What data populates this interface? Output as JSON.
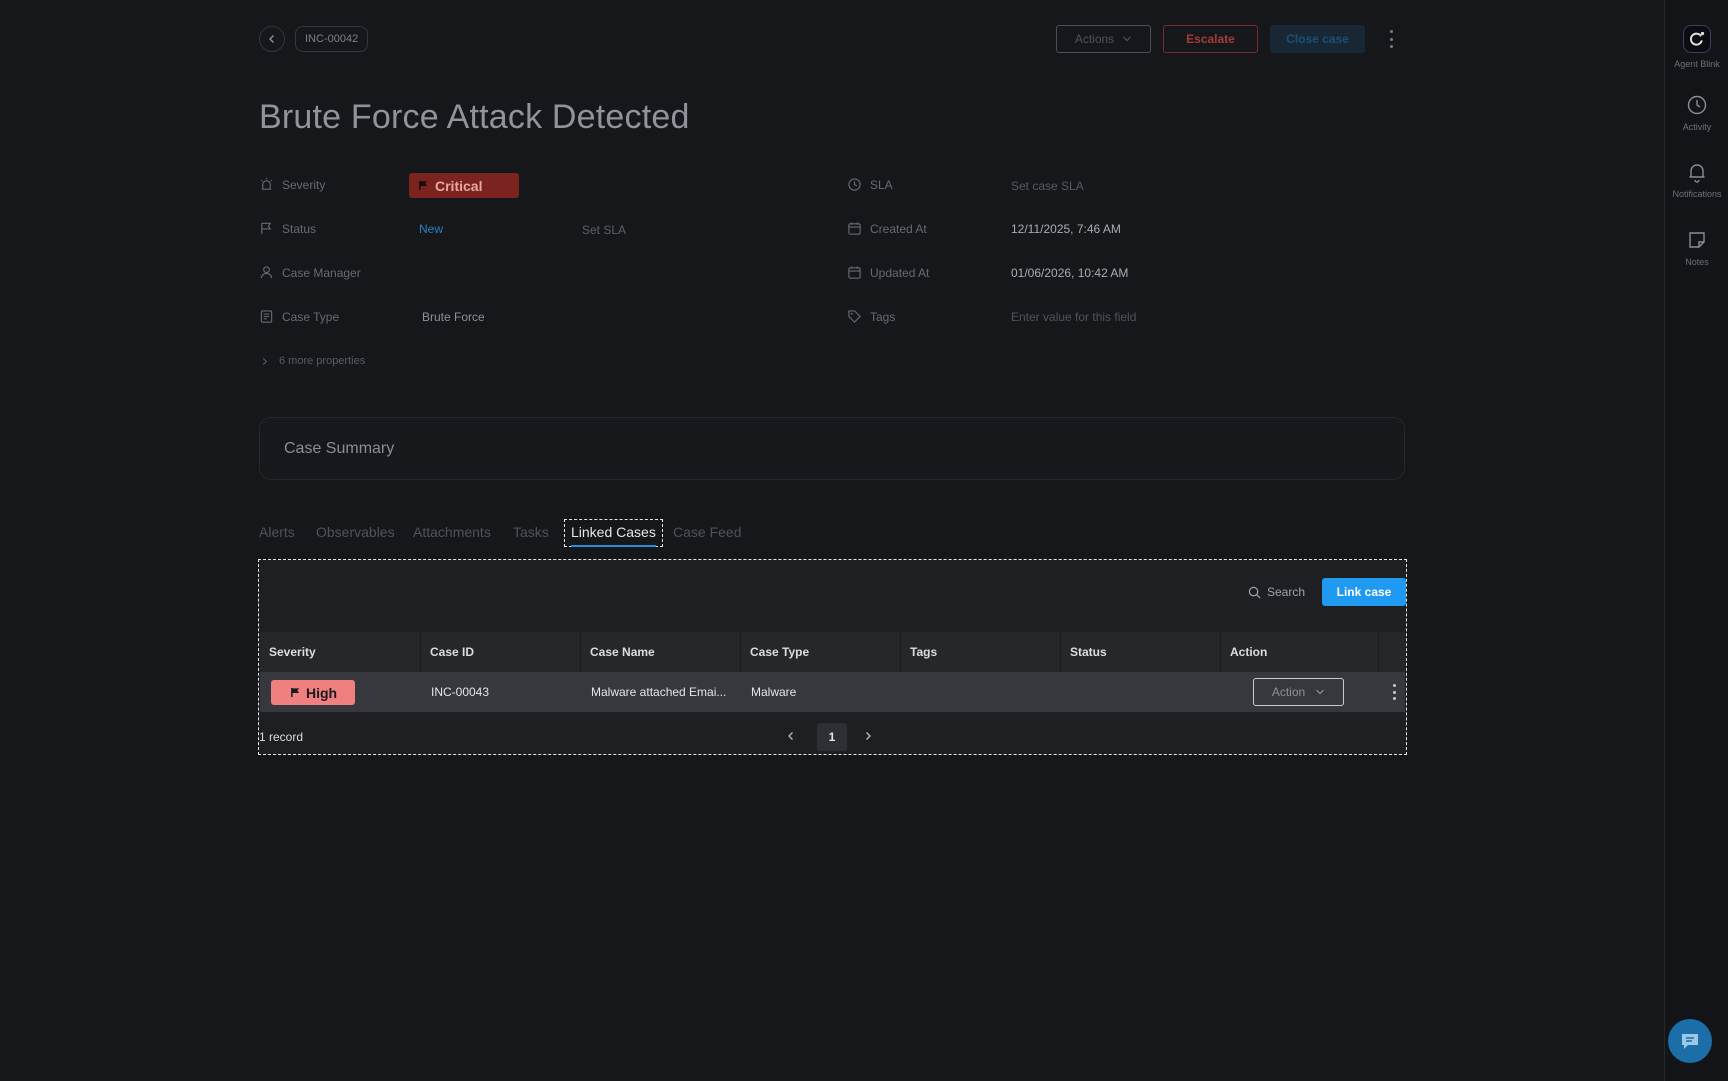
{
  "header": {
    "case_id": "INC-00042",
    "actions_label": "Actions",
    "escalate_label": "Escalate",
    "close_label": "Close case",
    "title": "Brute Force Attack Detected"
  },
  "properties": {
    "severity_label": "Severity",
    "severity_value": "Critical",
    "status_label": "Status",
    "status_value": "New",
    "set_sla_label": "Set SLA",
    "case_manager_label": "Case Manager",
    "case_type_label": "Case Type",
    "case_type_value": "Brute Force",
    "sla_label": "SLA",
    "sla_value": "Set case SLA",
    "created_label": "Created At",
    "created_value": "12/11/2025, 7:46 AM",
    "updated_label": "Updated At",
    "updated_value": "01/06/2026, 10:42 AM",
    "tags_label": "Tags",
    "tags_placeholder": "Enter value for this field",
    "more_label": "6 more properties"
  },
  "summary": {
    "title": "Case Summary"
  },
  "tabs": [
    {
      "label": "Alerts"
    },
    {
      "label": "Observables"
    },
    {
      "label": "Attachments"
    },
    {
      "label": "Tasks"
    },
    {
      "label": "Linked Cases",
      "active": true
    },
    {
      "label": "Case Feed"
    }
  ],
  "linked": {
    "search_label": "Search",
    "link_button": "Link case",
    "columns": [
      "Severity",
      "Case ID",
      "Case Name",
      "Case Type",
      "Tags",
      "Status",
      "Action"
    ],
    "rows": [
      {
        "severity": "High",
        "case_id": "INC-00043",
        "case_name": "Malware attached Emai...",
        "case_type": "Malware",
        "tags": "",
        "status": "",
        "action_label": "Action"
      }
    ],
    "record_count": "1 record",
    "page": "1"
  },
  "rail": {
    "agent_label": "Agent Blink",
    "activity_label": "Activity",
    "notifications_label": "Notifications",
    "notes_label": "Notes"
  },
  "colors": {
    "critical": "#7a231f",
    "high": "#f07f7f",
    "accent": "#1f9af0",
    "status_new": "#2a7fc4"
  }
}
